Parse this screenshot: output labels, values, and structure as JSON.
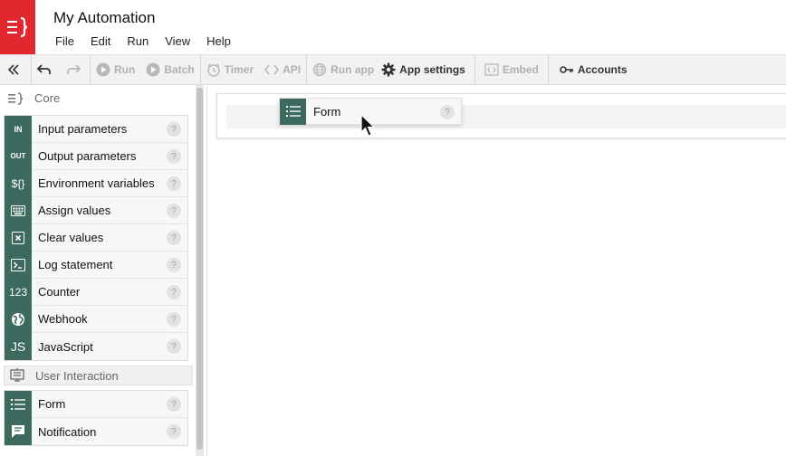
{
  "app": {
    "title": "My Automation",
    "brand_color": "#e0282e",
    "accent_color": "#3d6a5e"
  },
  "menu": {
    "items": [
      "File",
      "Edit",
      "Run",
      "View",
      "Help"
    ]
  },
  "toolbar": {
    "run_label": "Run",
    "batch_label": "Batch",
    "timer_label": "Timer",
    "api_label": "API",
    "run_app_label": "Run app",
    "app_settings_label": "App settings",
    "embed_label": "Embed",
    "accounts_label": "Accounts"
  },
  "sidebar": {
    "sections": [
      {
        "title": "Core",
        "items": [
          {
            "icon_text": "IN",
            "icon": "input-icon",
            "label": "Input parameters"
          },
          {
            "icon_text": "OUT",
            "icon": "output-icon",
            "label": "Output parameters"
          },
          {
            "icon_text": "${}",
            "icon": "variable-icon",
            "label": "Environment variables"
          },
          {
            "icon_text": "",
            "icon": "keyboard-icon",
            "label": "Assign values"
          },
          {
            "icon_text": "",
            "icon": "clear-icon",
            "label": "Clear values"
          },
          {
            "icon_text": "",
            "icon": "terminal-icon",
            "label": "Log statement"
          },
          {
            "icon_text": "123",
            "icon": "counter-icon",
            "label": "Counter"
          },
          {
            "icon_text": "",
            "icon": "globe-icon",
            "label": "Webhook"
          },
          {
            "icon_text": "JS",
            "icon": "javascript-icon",
            "label": "JavaScript"
          }
        ]
      },
      {
        "title": "User Interaction",
        "items": [
          {
            "icon_text": "",
            "icon": "list-icon",
            "label": "Form"
          },
          {
            "icon_text": "",
            "icon": "chat-icon",
            "label": "Notification"
          }
        ]
      }
    ],
    "help_glyph": "?"
  },
  "canvas": {
    "drag_chip_label": "Form",
    "help_glyph": "?"
  }
}
